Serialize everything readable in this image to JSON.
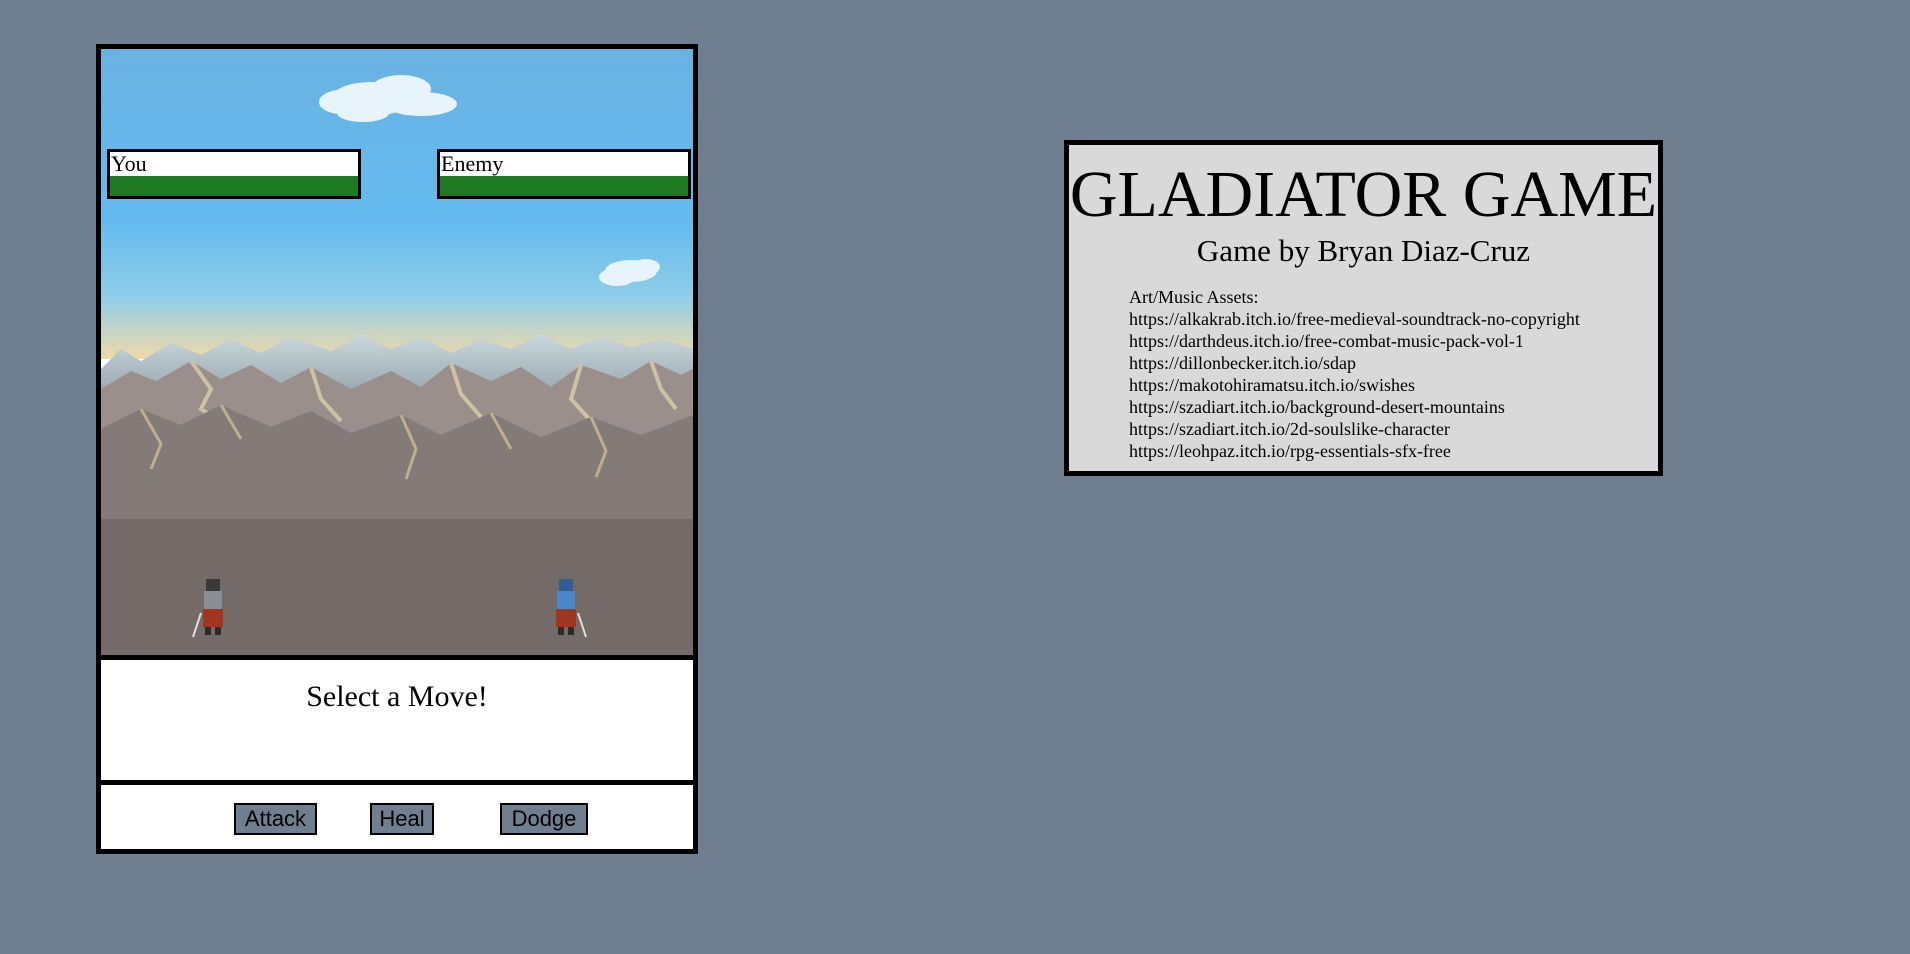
{
  "game": {
    "player": {
      "name": "You",
      "hp_fraction": 1.0
    },
    "enemy": {
      "name": "Enemy",
      "hp_fraction": 1.0
    },
    "message": "Select a Move!",
    "actions": {
      "attack": "Attack",
      "heal": "Heal",
      "dodge": "Dodge"
    },
    "colors": {
      "hp_bar": "#1e7a22",
      "button_bg": "#707f8f",
      "page_bg": "#707f8f",
      "sky": "#62b6ea",
      "ground": "#746a68"
    }
  },
  "credits": {
    "title": "GLADIATOR GAME",
    "author": "Game by Bryan Diaz-Cruz",
    "assets_heading": "Art/Music Assets:",
    "links": [
      "https://alkakrab.itch.io/free-medieval-soundtrack-no-copyright",
      "https://darthdeus.itch.io/free-combat-music-pack-vol-1",
      "https://dillonbecker.itch.io/sdap",
      "https://makotohiramatsu.itch.io/swishes",
      "https://szadiart.itch.io/background-desert-mountains",
      "https://szadiart.itch.io/2d-soulslike-character",
      "https://leohpaz.itch.io/rpg-essentials-sfx-free"
    ]
  }
}
